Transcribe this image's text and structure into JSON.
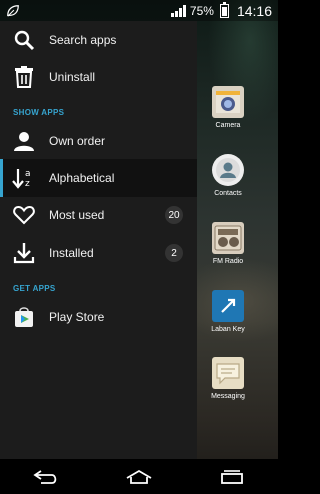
{
  "statusbar": {
    "battery_pct": "75%",
    "time": "14:16"
  },
  "drawer": {
    "items": [
      {
        "label": "Search apps",
        "icon": "search-icon"
      },
      {
        "label": "Uninstall",
        "icon": "trash-icon"
      }
    ],
    "show_apps_header": "SHOW APPS",
    "show_apps": [
      {
        "label": "Own order",
        "icon": "person-icon"
      },
      {
        "label": "Alphabetical",
        "icon": "sort-alpha-icon",
        "selected": true
      },
      {
        "label": "Most used",
        "icon": "heart-icon",
        "count": "20"
      },
      {
        "label": "Installed",
        "icon": "download-icon",
        "count": "2"
      }
    ],
    "get_apps_header": "GET APPS",
    "get_apps": [
      {
        "label": "Play Store",
        "icon": "play-store-icon"
      }
    ]
  },
  "home_apps": [
    {
      "label": "Camera",
      "icon": "camera-icon"
    },
    {
      "label": "Contacts",
      "icon": "contacts-icon"
    },
    {
      "label": "FM Radio",
      "icon": "radio-icon"
    },
    {
      "label": "Laban Key",
      "icon": "laban-key-icon"
    },
    {
      "label": "Messaging",
      "icon": "messaging-icon"
    }
  ],
  "colors": {
    "accent": "#36a4cf",
    "drawer_bg": "#1c1c1c"
  }
}
